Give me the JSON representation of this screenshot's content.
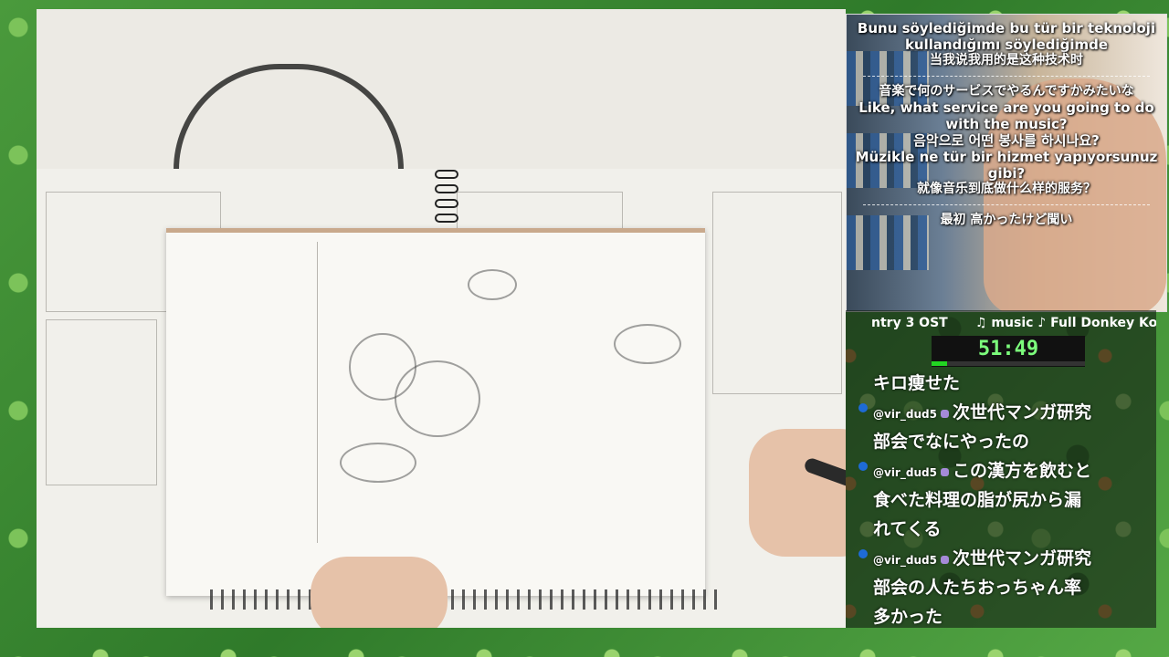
{
  "stream": {
    "subtitles": {
      "block1": [
        "Bunu söylediğimde bu tür bir teknoloji",
        "kullandığımı söylediğimde",
        "当我说我用的是这种技术时"
      ],
      "block2": [
        "音楽で何のサービスでやるんですかみたいな",
        "Like, what service are you going to do",
        "with the music?",
        "음악으로 어떤 봉사를 하시나요?",
        "Müzikle ne tür bir hizmet yapıyorsunuz",
        "gibi?",
        "就像音乐到底做什么样的服务？"
      ],
      "block3": [
        "最初 高かったけど聞い"
      ]
    },
    "now_playing": {
      "left": "ntry 3 OST",
      "right": "♫ music ♪ Full Donkey Kor"
    },
    "timer": {
      "value": "51:49",
      "progress_fraction": 0.1
    },
    "chat": [
      {
        "user": "",
        "text": "キロ痩せた",
        "dot": false
      },
      {
        "user": "@vir_dud5",
        "text": "次世代マンガ研究",
        "dot": true
      },
      {
        "user": "",
        "text": "部会でなにやったの",
        "dot": false
      },
      {
        "user": "@vir_dud5",
        "text": "この漢方を飲むと",
        "dot": true
      },
      {
        "user": "",
        "text": "食べた料理の脂が尻から漏",
        "dot": false
      },
      {
        "user": "",
        "text": "れてくる",
        "dot": false
      },
      {
        "user": "@vir_dud5",
        "text": "次世代マンガ研究",
        "dot": true
      },
      {
        "user": "",
        "text": "部会の人たちおっちゃん率",
        "dot": false
      },
      {
        "user": "",
        "text": "多かった",
        "dot": false
      }
    ]
  },
  "colors": {
    "accent_timer": "#7CFC7C",
    "chat_dot": "#1e6bd6",
    "background_green": "#3f8a34"
  },
  "icons": [
    "user-badge-icon",
    "chat-dot-icon"
  ]
}
